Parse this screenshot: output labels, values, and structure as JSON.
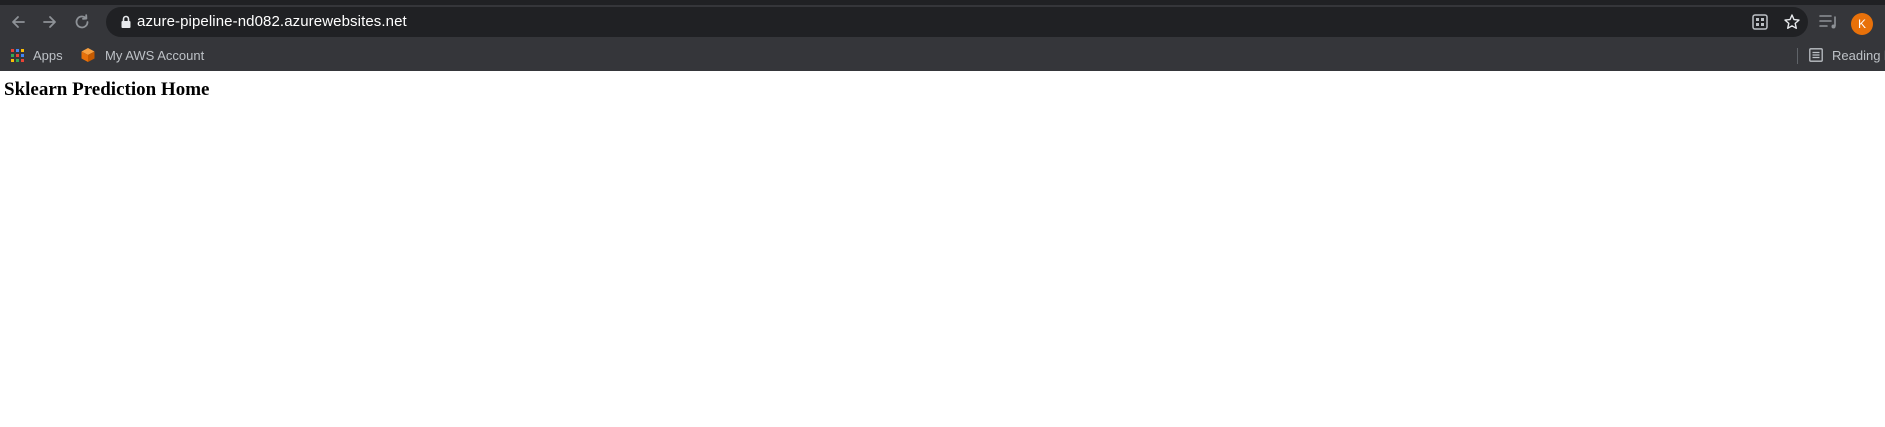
{
  "browser": {
    "url": "azure-pipeline-nd082.azurewebsites.net",
    "profile_initial": "K",
    "accent_color": "#e8710a",
    "icons": {
      "back": "arrow-left-icon",
      "forward": "arrow-right-icon",
      "reload": "reload-icon",
      "secure": "lock-icon",
      "qr": "qr-code-icon",
      "bookmark_star": "star-icon",
      "media": "media-controls-icon"
    }
  },
  "bookmarks_bar": {
    "items": [
      {
        "label": "Apps",
        "icon": "apps-grid-icon"
      },
      {
        "label": "My AWS Account",
        "icon": "aws-cube-icon"
      }
    ],
    "reading_list_label": "Reading list"
  },
  "page": {
    "heading": "Sklearn Prediction Home"
  }
}
